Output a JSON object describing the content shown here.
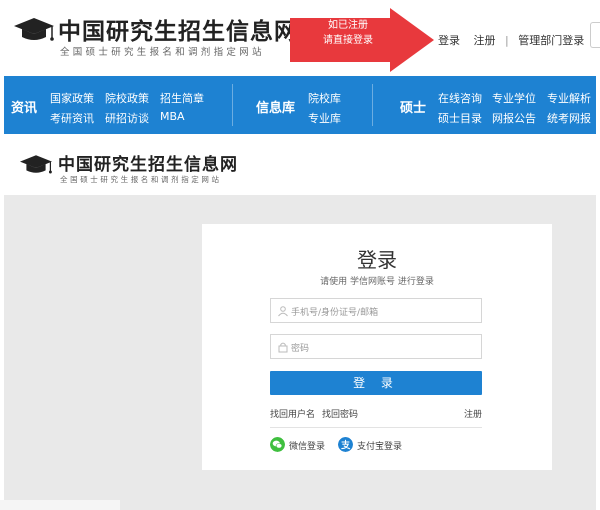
{
  "header": {
    "logo_title": "中国研究生招生信息网",
    "logo_subtitle": "全国硕士研究生报名和调剂指定网站",
    "arrow_note_line1": "如已注册",
    "arrow_note_line2": "请直接登录",
    "links": {
      "login": "登录",
      "register": "注册",
      "separator": "|",
      "admin_login": "管理部门登录"
    },
    "arrow_color": "#e8393d"
  },
  "nav": {
    "background": "#1e82d2",
    "groups": [
      {
        "category": "资讯",
        "items": [
          "国家政策",
          "院校政策",
          "招生简章",
          "考研资讯",
          "研招访谈",
          "MBA"
        ]
      },
      {
        "category": "信息库",
        "items": [
          "院校库",
          "专业库"
        ]
      },
      {
        "category": "硕士",
        "items": [
          "在线咨询",
          "专业学位",
          "专业解析",
          "硕士目录",
          "网报公告",
          "统考网报"
        ]
      }
    ]
  },
  "logo2": {
    "title": "中国研究生招生信息网",
    "subtitle": "全国硕士研究生报名和调剂指定网站"
  },
  "login": {
    "title": "登录",
    "tip": "请使用 学信网账号 进行登录",
    "username_placeholder": "手机号/身份证号/邮箱",
    "password_placeholder": "密码",
    "submit_label": "登 录",
    "forgot_username": "找回用户名",
    "forgot_password": "找回密码",
    "register": "注册",
    "wechat_label": "微信登录",
    "alipay_label": "支付宝登录",
    "wechat_color": "#3fbf3f",
    "alipay_color": "#1e82d2"
  }
}
